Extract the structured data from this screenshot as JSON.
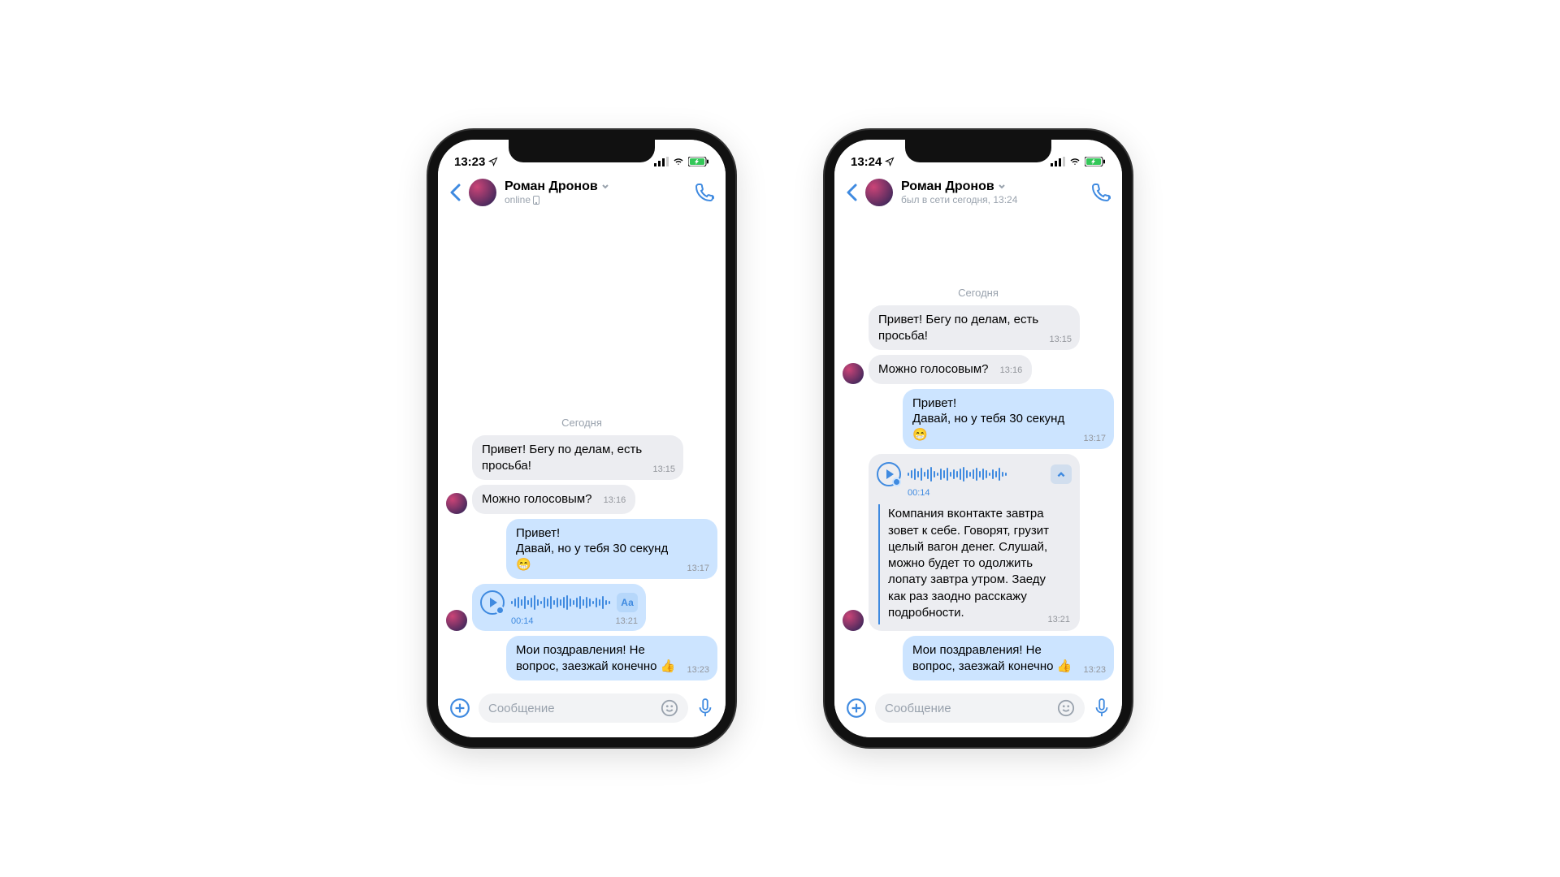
{
  "colors": {
    "vk_blue": "#3F8AE0",
    "bubble_in": "#ECEDF1",
    "bubble_out": "#CCE4FF"
  },
  "phones": [
    {
      "statusbar": {
        "time": "13:23"
      },
      "header": {
        "name": "Роман Дронов",
        "sub": "online",
        "sub_icon": "mobile-icon"
      },
      "date_separator": "Сегодня",
      "messages": [
        {
          "dir": "in",
          "text": "Привет! Бегу по делам, есть просьба!",
          "time": "13:15",
          "show_avatar": false
        },
        {
          "dir": "in",
          "text": "Можно голосовым?",
          "time": "13:16",
          "short": true,
          "show_avatar": true
        },
        {
          "dir": "out",
          "text": "Привет!\nДавай, но у тебя 30 секунд 😁",
          "time": "13:17"
        },
        {
          "dir": "in",
          "kind": "voice",
          "duration": "00:14",
          "time": "13:21",
          "expand_label": "Аа",
          "show_avatar": true
        },
        {
          "dir": "out",
          "text": "Мои поздравления! Не вопрос, заезжай конечно 👍",
          "time": "13:23"
        }
      ],
      "input": {
        "placeholder": "Сообщение"
      }
    },
    {
      "statusbar": {
        "time": "13:24"
      },
      "header": {
        "name": "Роман Дронов",
        "sub": "был в сети сегодня, 13:24",
        "sub_icon": null
      },
      "date_separator": "Сегодня",
      "messages": [
        {
          "dir": "in",
          "text": "Привет! Бегу по делам, есть просьба!",
          "time": "13:15",
          "show_avatar": false
        },
        {
          "dir": "in",
          "text": "Можно голосовым?",
          "time": "13:16",
          "short": true,
          "show_avatar": true
        },
        {
          "dir": "out",
          "text": "Привет!\nДавай, но у тебя 30 секунд 😁",
          "time": "13:17"
        },
        {
          "dir": "in",
          "kind": "voice_transcript",
          "duration": "00:14",
          "time": "13:21",
          "transcript": "Компания вконтакте завтра зовет к себе. Говорят, грузит целый вагон денег. Слушай, можно будет то одолжить лопату завтра утром. Заеду как раз заодно расскажу подробности.",
          "show_avatar": true
        },
        {
          "dir": "out",
          "text": "Мои поздравления! Не вопрос, заезжай конечно 👍",
          "time": "13:23"
        }
      ],
      "input": {
        "placeholder": "Сообщение"
      }
    }
  ]
}
